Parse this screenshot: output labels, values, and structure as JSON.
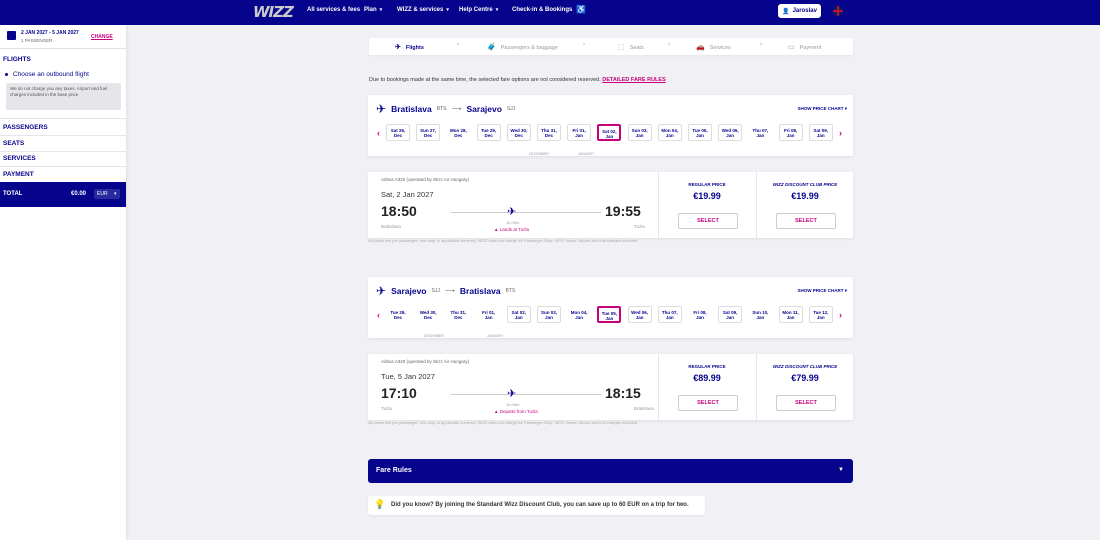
{
  "nav": {
    "logo": "WIZZ",
    "items": [
      "All services & fees",
      "Plan",
      "WIZZ & services",
      "Help Centre",
      "Check-in & Bookings"
    ],
    "user": "Jaroslav"
  },
  "sidebar": {
    "dates": "2 JAN 2027 - 5 JAN 2027",
    "passengers": "1 PASSENGER",
    "change": "CHANGE",
    "flights": "FLIGHTS",
    "choose": "Choose an outbound flight",
    "note": "We do not charge you any taxes. Airport and fuel charges included in the base price",
    "passengers_sec": "PASSENGERS",
    "seats": "SEATS",
    "services": "SERVICES",
    "payment": "PAYMENT",
    "total_label": "TOTAL",
    "total_amount": "€0.00",
    "currency": "EUR"
  },
  "steps": [
    "Flights",
    "Passengers & baggage",
    "Seats",
    "Services",
    "Payment"
  ],
  "warning": {
    "text": "Due to bookings made at the same time, the selected fare options are not considered reserved.",
    "link": "DETAILED FARE RULES"
  },
  "show_price_chart": "SHOW PRICE CHART",
  "outbound": {
    "from": "Bratislava",
    "from_code": "BTS",
    "to": "Sarajevo",
    "to_code": "SJJ",
    "days": [
      [
        "Sat 26,",
        "Dec"
      ],
      [
        "Sun 27,",
        "Dec"
      ],
      [
        "Mon 28,",
        "Dec"
      ],
      [
        "Tue 29,",
        "Dec"
      ],
      [
        "Wed 30,",
        "Dec"
      ],
      [
        "Thu 31,",
        "Dec"
      ],
      [
        "Fri 01,",
        "Jan"
      ],
      [
        "Sat 02,",
        "Jan"
      ],
      [
        "Sun 03,",
        "Jan"
      ],
      [
        "Mon 04,",
        "Jan"
      ],
      [
        "Tue 05,",
        "Jan"
      ],
      [
        "Wed 06,",
        "Jan"
      ],
      [
        "Thu 07,",
        "Jan"
      ],
      [
        "Fri 08,",
        "Jan"
      ],
      [
        "Sat 09,",
        "Jan"
      ]
    ],
    "months": [
      "DECEMBER",
      "JANUARY"
    ],
    "aircraft": "Airbus A320 (operated by Wizz Air Hungary)",
    "date": "Sat, 2 Jan 2027",
    "dep": "18:50",
    "arr": "19:55",
    "dep_code": "BTS",
    "arr_code": "SJJ",
    "dep_city": "Bratislava",
    "arr_city": "Tuzla",
    "duration": "1h 05m",
    "note": "Lands at Tuzla",
    "regular_label": "REGULAR PRICE",
    "regular_price": "€19.99",
    "discount_label": "WIZZ DISCOUNT CLUB PRICE",
    "discount_price": "€19.99",
    "select": "SELECT",
    "tc": "All prices are per passenger, one-way, in applicable currency. WIZZ does not charge Air Passenger Duty / APD / taxes. Airport and fuel charges included."
  },
  "return": {
    "from": "Sarajevo",
    "from_code": "SJJ",
    "to": "Bratislava",
    "to_code": "BTS",
    "days": [
      [
        "Tue 29,",
        "Dec"
      ],
      [
        "Wed 30,",
        "Dec"
      ],
      [
        "Thu 31,",
        "Dec"
      ],
      [
        "Fri 01,",
        "Jan"
      ],
      [
        "Sat 02,",
        "Jan"
      ],
      [
        "Sun 03,",
        "Jan"
      ],
      [
        "Mon 04,",
        "Jan"
      ],
      [
        "Tue 05,",
        "Jan"
      ],
      [
        "Wed 06,",
        "Jan"
      ],
      [
        "Thu 07,",
        "Jan"
      ],
      [
        "Fri 08,",
        "Jan"
      ],
      [
        "Sat 09,",
        "Jan"
      ],
      [
        "Sun 10,",
        "Jan"
      ],
      [
        "Mon 11,",
        "Jan"
      ],
      [
        "Tue 12,",
        "Jan"
      ]
    ],
    "months": [
      "DECEMBER",
      "JANUARY"
    ],
    "aircraft": "Airbus A320 (operated by Wizz Air Hungary)",
    "date": "Tue, 5 Jan 2027",
    "dep": "17:10",
    "arr": "18:15",
    "dep_code": "SJJ",
    "arr_code": "BTS",
    "dep_city": "Tuzla",
    "arr_city": "Bratislava",
    "duration": "1h 05m",
    "note": "Departs from Tuzla",
    "regular_label": "REGULAR PRICE",
    "regular_price": "€89.99",
    "discount_label": "WIZZ DISCOUNT CLUB PRICE",
    "discount_price": "€79.99",
    "select": "SELECT",
    "tc": "All prices are per passenger, one-way, in applicable currency. WIZZ does not charge Air Passenger Duty / APD / taxes. Airport and fuel charges included."
  },
  "fare_rules": "Fare Rules",
  "tip": "Did you know? By joining the Standard Wizz Discount Club, you can save up to 60 EUR on a trip for two."
}
